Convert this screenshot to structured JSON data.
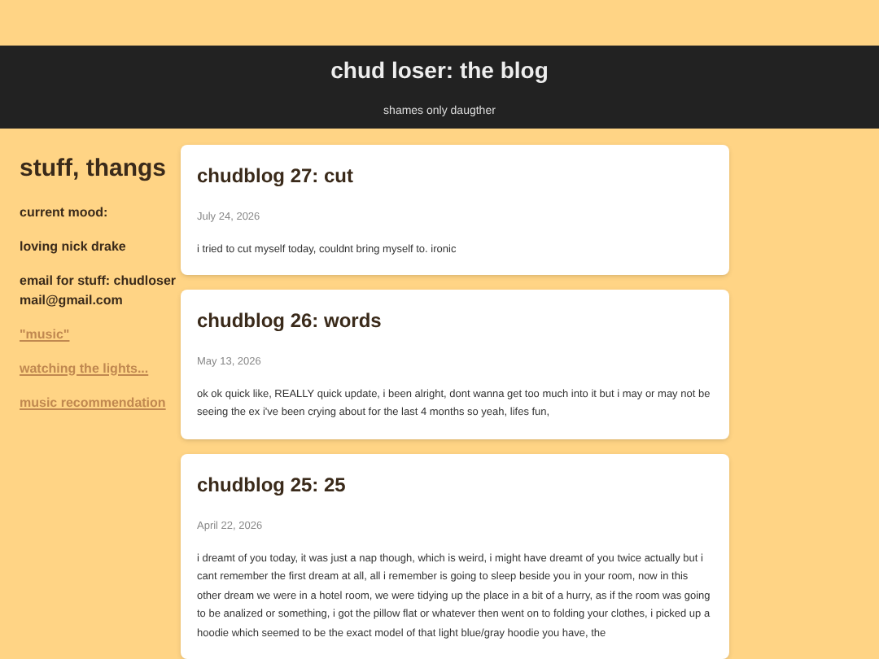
{
  "header": {
    "title": "chud loser: the blog",
    "subtitle": "shames only daugther"
  },
  "sidebar": {
    "title": "stuff, thangs",
    "items": [
      {
        "kind": "text",
        "text": "current mood:"
      },
      {
        "kind": "text",
        "text": "loving nick drake"
      },
      {
        "kind": "text",
        "text": "email for stuff: chudlosermail@gmail.com"
      },
      {
        "kind": "link",
        "text": "\"music\""
      },
      {
        "kind": "link",
        "text": "watching the lights..."
      },
      {
        "kind": "link",
        "text": "music recommendation"
      }
    ]
  },
  "posts": [
    {
      "title": "chudblog 27: cut",
      "date": "July 24, 2026",
      "body": "i tried to cut myself today, couldnt bring myself to. ironic"
    },
    {
      "title": "chudblog 26: words",
      "date": "May 13, 2026",
      "body": "ok ok quick like, REALLY quick update, i been alright, dont wanna get too much into it but i may or may not be seeing the ex i've been crying about for the last 4 months so yeah, lifes fun,"
    },
    {
      "title": "chudblog 25: 25",
      "date": "April 22, 2026",
      "body": "i dreamt of you today, it was just a nap though, which is weird, i might have dreamt of you twice actually but i cant remember the first dream at all, all i remember is going to sleep beside you in your room, now in this other dream we were in a hotel room, we were tidying up the place in a bit of a hurry, as if the room was going to be analized or something, i got the pillow flat or whatever then went on to folding your clothes, i picked up a hoodie which seemed to be the exact model of that light blue/gray hoodie you have, the"
    }
  ]
}
